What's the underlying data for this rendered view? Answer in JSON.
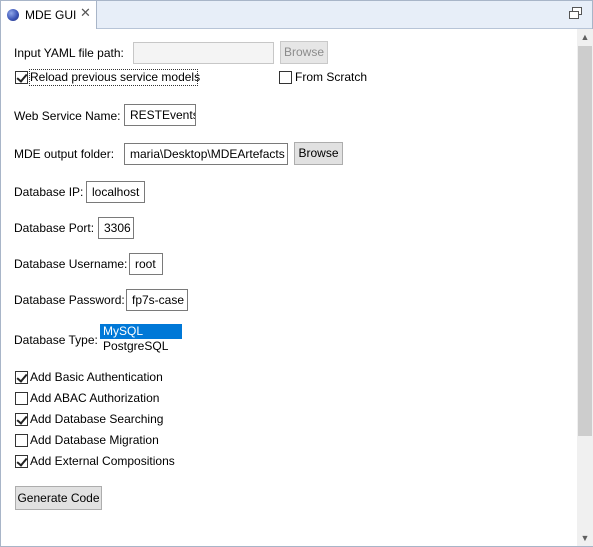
{
  "tab": {
    "title": "MDE GUI",
    "icon": "eclipse-plugin-icon",
    "close_icon": "close-icon"
  },
  "view": {
    "restore_icon": "restore-icon"
  },
  "form": {
    "yaml_label": "Input YAML file path:",
    "yaml_value": "",
    "yaml_browse": "Browse",
    "reload_label": "Reload previous service models",
    "reload_checked": true,
    "scratch_label": "From Scratch",
    "scratch_checked": false,
    "ws_label": "Web Service Name:",
    "ws_value": "RESTEvents",
    "output_label": "MDE output folder:",
    "output_value": "maria\\Desktop\\MDEArtefacts",
    "output_browse": "Browse",
    "ip_label": "Database IP:",
    "ip_value": "localhost",
    "port_label": "Database Port:",
    "port_value": "3306",
    "user_label": "Database Username:",
    "user_value": "root",
    "pass_label": "Database Password:",
    "pass_value": "fp7s-case",
    "type_label": "Database Type:",
    "type_options": [
      "MySQL",
      "PostgreSQL"
    ],
    "type_selected": "MySQL",
    "options": [
      {
        "label": "Add Basic Authentication",
        "checked": true
      },
      {
        "label": "Add ABAC Authorization",
        "checked": false
      },
      {
        "label": "Add Database Searching",
        "checked": true
      },
      {
        "label": "Add Database Migration",
        "checked": false
      },
      {
        "label": "Add External Compositions",
        "checked": true
      }
    ],
    "generate": "Generate Code"
  },
  "scrollbar": {
    "up_icon": "scroll-up-arrow-icon",
    "down_icon": "scroll-down-arrow-icon"
  }
}
